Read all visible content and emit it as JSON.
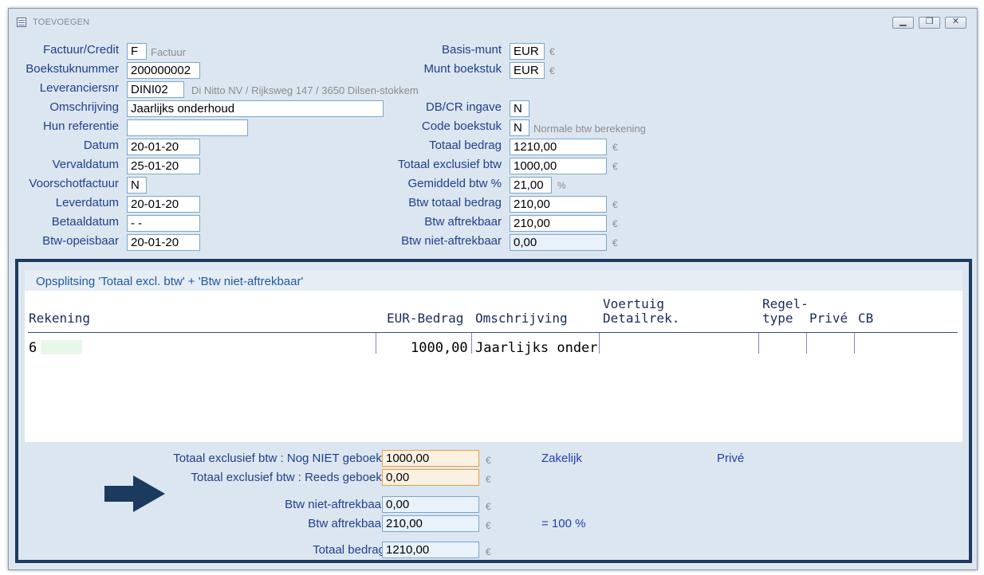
{
  "window": {
    "title": "TOEVOEGEN"
  },
  "left_form": [
    {
      "label": "Factuur/Credit",
      "value": "F",
      "hint": "Factuur"
    },
    {
      "label": "Boekstuknummer",
      "value": "200000002"
    },
    {
      "label": "Leveranciersnr",
      "value": "DINI02",
      "hint": "Di Nitto NV / Rijksweg 147 / 3650 Dilsen-stokkem"
    },
    {
      "label": "Omschrijving",
      "value": "Jaarlijks onderhoud"
    },
    {
      "label": "Hun referentie",
      "value": ""
    },
    {
      "label": "Datum",
      "value": "20-01-20"
    },
    {
      "label": "Vervaldatum",
      "value": "25-01-20"
    },
    {
      "label": "Voorschotfactuur",
      "value": "N"
    },
    {
      "label": "Leverdatum",
      "value": "20-01-20"
    },
    {
      "label": "Betaaldatum",
      "value": "- -"
    },
    {
      "label": "Btw-opeisbaar",
      "value": "20-01-20"
    }
  ],
  "right_form": [
    {
      "label": "Basis-munt",
      "value": "EUR",
      "unit": "€"
    },
    {
      "label": "Munt boekstuk",
      "value": "EUR",
      "unit": "€"
    },
    {
      "label": "DB/CR ingave",
      "value": "N"
    },
    {
      "label": "Code boekstuk",
      "value": "N",
      "hint": "Normale btw berekening"
    },
    {
      "label": "Totaal bedrag",
      "value": "1210,00",
      "unit": "€"
    },
    {
      "label": "Totaal exclusief btw",
      "value": "1000,00",
      "unit": "€"
    },
    {
      "label": "Gemiddeld btw %",
      "value": "21,00",
      "unit": "%"
    },
    {
      "label": "Btw totaal bedrag",
      "value": "210,00",
      "unit": "€"
    },
    {
      "label": "Btw aftrekbaar",
      "value": "210,00",
      "unit": "€"
    },
    {
      "label": "Btw niet-aftrekbaar",
      "value": "0,00",
      "unit": "€"
    }
  ],
  "split_panel": {
    "title": "Opsplitsing 'Totaal excl. btw' + 'Btw niet-aftrekbaar'",
    "columns": {
      "rekening": "Rekening",
      "bedrag": "EUR-Bedrag",
      "omschrijving": "Omschrijving",
      "voertuig_1": "Voertuig",
      "voertuig_2": "Detailrek.",
      "regel_1": "Regel-",
      "regel_2": "type",
      "prive": "Privé",
      "cb": "CB"
    },
    "row": {
      "rekening": "6",
      "bedrag": "1000,00",
      "omschrijving": "Jaarlijks onder"
    }
  },
  "summary": {
    "niet_geboekt_label": "Totaal exclusief btw : Nog NIET geboekt",
    "niet_geboekt_value": "1000,00",
    "reeds_geboekt_label": "Totaal exclusief btw : Reeds geboekt",
    "reeds_geboekt_value": "0,00",
    "btw_niet_aftrekbaar_label": "Btw niet-aftrekbaar",
    "btw_niet_aftrekbaar_value": "0,00",
    "btw_aftrekbaar_label": "Btw aftrekbaar",
    "btw_aftrekbaar_value": "210,00",
    "totaal_label": "Totaal bedrag",
    "totaal_value": "1210,00",
    "currency": "€",
    "zakelijk": "Zakelijk",
    "prive": "Privé",
    "percent_note": "= 100 %"
  },
  "colors": {
    "label": "#1f3f8c",
    "frame": "#1c3a5e",
    "background": "#dce6f0",
    "accent_orange": "#e9a13c"
  },
  "icons": {
    "arrow": "arrow-right-icon"
  }
}
